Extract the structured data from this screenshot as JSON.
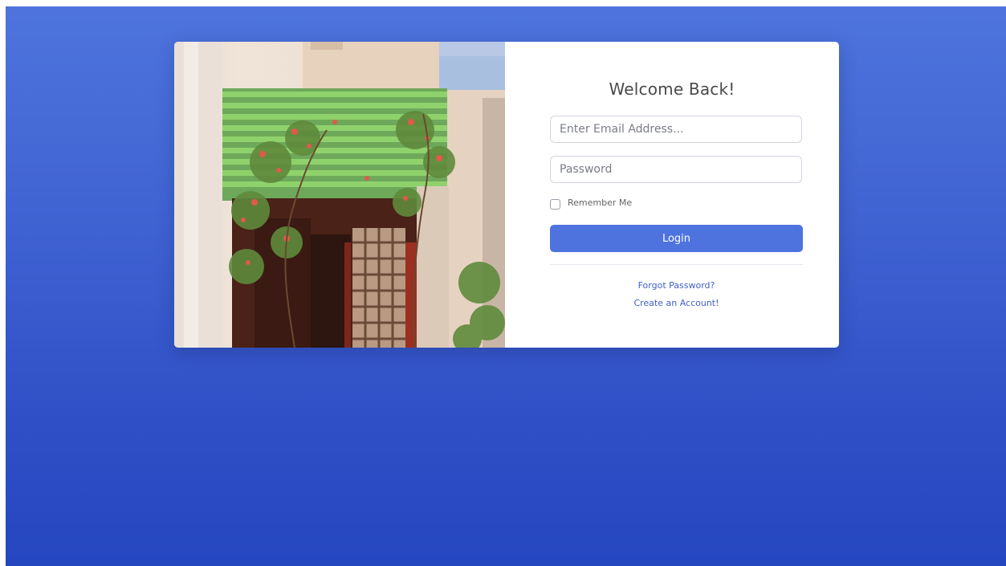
{
  "login": {
    "title": "Welcome Back!",
    "email_placeholder": "Enter Email Address...",
    "password_placeholder": "Password",
    "remember_label": "Remember Me",
    "login_label": "Login",
    "forgot_label": "Forgot Password?",
    "create_label": "Create an Account!"
  },
  "theme": {
    "accent": "#4e73df",
    "background_top": "#4e74dc",
    "background_bottom": "#2446bf"
  }
}
